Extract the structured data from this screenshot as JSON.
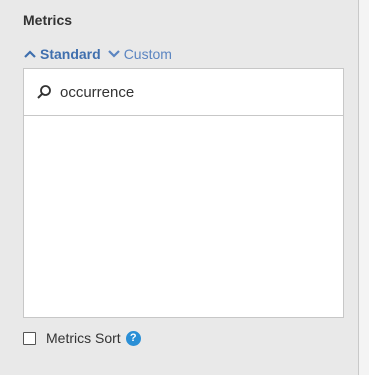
{
  "panel": {
    "title": "Metrics",
    "accent_color": "#3f6fae",
    "link_color": "#5b85c1"
  },
  "tabs": [
    {
      "label": "Standard",
      "active": true,
      "icon": "chevron-up-icon"
    },
    {
      "label": "Custom",
      "active": false,
      "icon": "chevron-down-icon"
    }
  ],
  "search": {
    "value": "occurrence",
    "icon": "search-icon"
  },
  "results": {
    "items": []
  },
  "sort": {
    "label": "Metrics Sort",
    "checked": false,
    "help_icon": "help-icon",
    "help_glyph": "?",
    "help_color": "#2a8fd6"
  }
}
